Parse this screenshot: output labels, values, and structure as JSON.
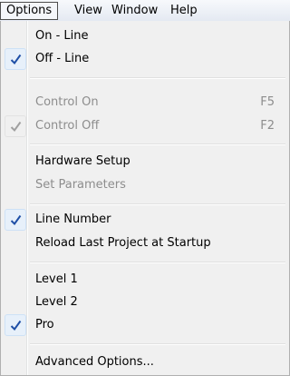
{
  "menubar": {
    "items": [
      {
        "label": "Options"
      },
      {
        "label": "View"
      },
      {
        "label": "Window"
      },
      {
        "label": "Help"
      }
    ]
  },
  "dropdown": {
    "items": [
      {
        "label": "On - Line",
        "checked": false,
        "enabled": true
      },
      {
        "label": "Off - Line",
        "checked": true,
        "enabled": true
      },
      {
        "label": "Control On",
        "shortcut": "F5",
        "checked": false,
        "enabled": false
      },
      {
        "label": "Control Off",
        "shortcut": "F2",
        "checked": true,
        "enabled": false
      },
      {
        "label": "Hardware Setup",
        "checked": false,
        "enabled": true
      },
      {
        "label": "Set Parameters",
        "checked": false,
        "enabled": false
      },
      {
        "label": "Line Number",
        "checked": true,
        "enabled": true
      },
      {
        "label": "Reload Last Project at Startup",
        "checked": false,
        "enabled": true
      },
      {
        "label": "Level 1",
        "checked": false,
        "enabled": true
      },
      {
        "label": "Level 2",
        "checked": false,
        "enabled": true
      },
      {
        "label": "Pro",
        "checked": true,
        "enabled": true
      },
      {
        "label": "Advanced Options...",
        "checked": false,
        "enabled": true
      }
    ]
  },
  "colors": {
    "check_color": "#1f4fa6",
    "check_disabled_color": "#a0a0a0"
  }
}
